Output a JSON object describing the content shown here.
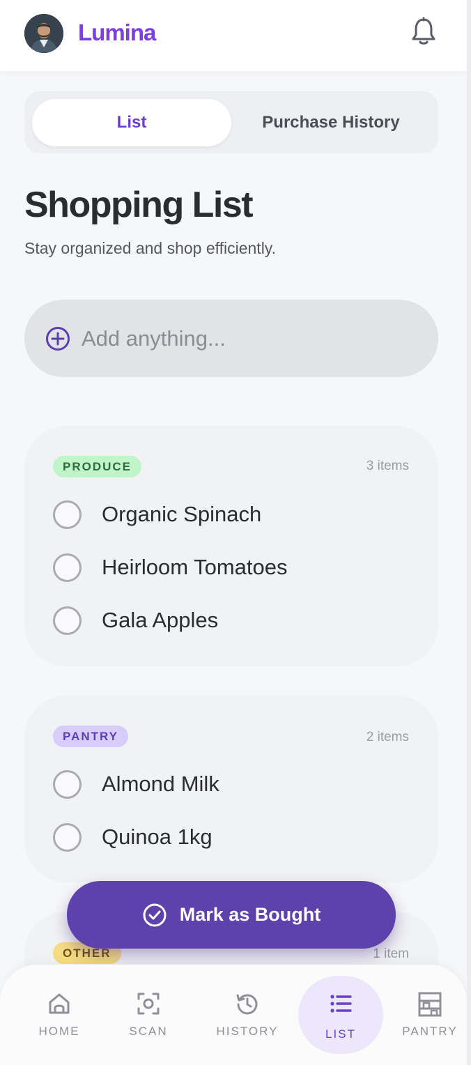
{
  "header": {
    "brand": "Lumina",
    "avatar_icon": "user-avatar",
    "notification_icon": "bell-icon"
  },
  "tabs": [
    {
      "label": "List",
      "active": true
    },
    {
      "label": "Purchase History",
      "active": false
    }
  ],
  "page": {
    "title": "Shopping List",
    "subtitle": "Stay organized and shop efficiently."
  },
  "add_item": {
    "placeholder": "Add anything...",
    "value": ""
  },
  "categories": [
    {
      "name": "PRODUCE",
      "count": "3 items",
      "badge_bg": "#bff5c9",
      "badge_fg": "#2f6b3d",
      "items": [
        "Organic Spinach",
        "Heirloom Tomatoes",
        "Gala Apples"
      ]
    },
    {
      "name": "PANTRY",
      "count": "2 items",
      "badge_bg": "#d8ccfa",
      "badge_fg": "#5b3fb0",
      "items": [
        "Almond Milk",
        "Quinoa 1kg"
      ]
    },
    {
      "name": "OTHER",
      "count": "1 item",
      "badge_bg": "#f6dc83",
      "badge_fg": "#6b5413",
      "items": []
    }
  ],
  "action": {
    "label": "Mark as Bought"
  },
  "nav": [
    {
      "label": "HOME",
      "icon": "home-icon",
      "active": false
    },
    {
      "label": "SCAN",
      "icon": "scan-icon",
      "active": false
    },
    {
      "label": "HISTORY",
      "icon": "history-icon",
      "active": false
    },
    {
      "label": "LIST",
      "icon": "list-icon",
      "active": true
    },
    {
      "label": "PANTRY",
      "icon": "pantry-icon",
      "active": false
    }
  ],
  "colors": {
    "accent": "#7a3fe0",
    "button": "#5e42ab",
    "text": "#2b2c30"
  }
}
